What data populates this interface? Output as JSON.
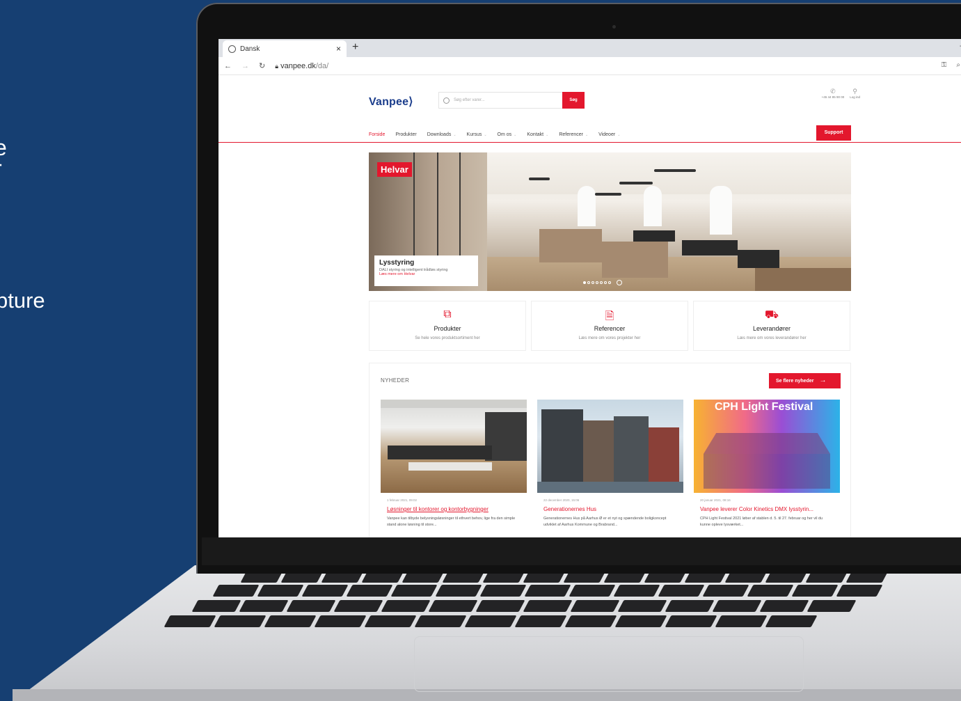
{
  "left_text": {
    "line1": "e",
    "line2": "r",
    "line3": "pture"
  },
  "browser": {
    "tab_title": "Dansk",
    "tab_close": "×",
    "new_tab": "+",
    "window_minimize": "–",
    "url_host": "vanpee.dk",
    "url_path": "/da/"
  },
  "site": {
    "logo": "Vanpee⟩",
    "search": {
      "placeholder": "Søg efter varer...",
      "button_label": "Søg"
    },
    "phone": "+45 44 85 90 00",
    "login": "Log ind",
    "nav": [
      {
        "label": "Forside",
        "active": true,
        "dropdown": false
      },
      {
        "label": "Produkter",
        "active": false,
        "dropdown": false
      },
      {
        "label": "Downloads",
        "active": false,
        "dropdown": true
      },
      {
        "label": "Kursus",
        "active": false,
        "dropdown": true
      },
      {
        "label": "Om os",
        "active": false,
        "dropdown": true
      },
      {
        "label": "Kontakt",
        "active": false,
        "dropdown": true
      },
      {
        "label": "Referencer",
        "active": false,
        "dropdown": true
      },
      {
        "label": "Videoer",
        "active": false,
        "dropdown": true
      }
    ],
    "support_label": "Support",
    "hero": {
      "badge": "Helvar",
      "heading": "Lysstyring",
      "subtitle": "DALI styring og intelligent trådløs styring",
      "link": "Læs mere om Helvar",
      "slide_count": 7,
      "active_slide": 1
    },
    "quick_links": [
      {
        "icon": "boxes-icon",
        "title": "Produkter",
        "desc": "Se hele vores produktsortiment her"
      },
      {
        "icon": "document-icon",
        "title": "Referencer",
        "desc": "Læs mere om vores projekter her"
      },
      {
        "icon": "truck-icon",
        "title": "Leverandører",
        "desc": "Læs mere om vores leverandører her"
      }
    ],
    "news": {
      "heading": "NYHEDER",
      "more_label": "Se flere nyheder",
      "articles": [
        {
          "date": "1 februar 2021, 09:02",
          "title": "Løsninger til kontorer og kontorbygninger",
          "desc": "Vanpee kan tilbyde belysningsløsninger til ethvert behov, lige fra den simple stand alone løsning til store..."
        },
        {
          "date": "22 december 2020, 15:06",
          "title": "Generationernes Hus",
          "desc": "Generationernes Hus på Aarhus Ø er et nyt og spændende boligkoncept udviklet af Aarhus Kommune og Brabrand..."
        },
        {
          "date": "20 januar 2021, 08:16",
          "title": "Vanpee leverer Color Kinetics DMX lysstyrin...",
          "desc": "CPH Light Festival 2021 løber af stablen d. 5. til 27. februar og her vil du kunne opleve lysværket...",
          "image_caption": "CPH Light Festival"
        }
      ]
    }
  },
  "colors": {
    "brand_red": "#e3172d",
    "brand_blue": "#1b3d8c",
    "background": "#163f72"
  }
}
